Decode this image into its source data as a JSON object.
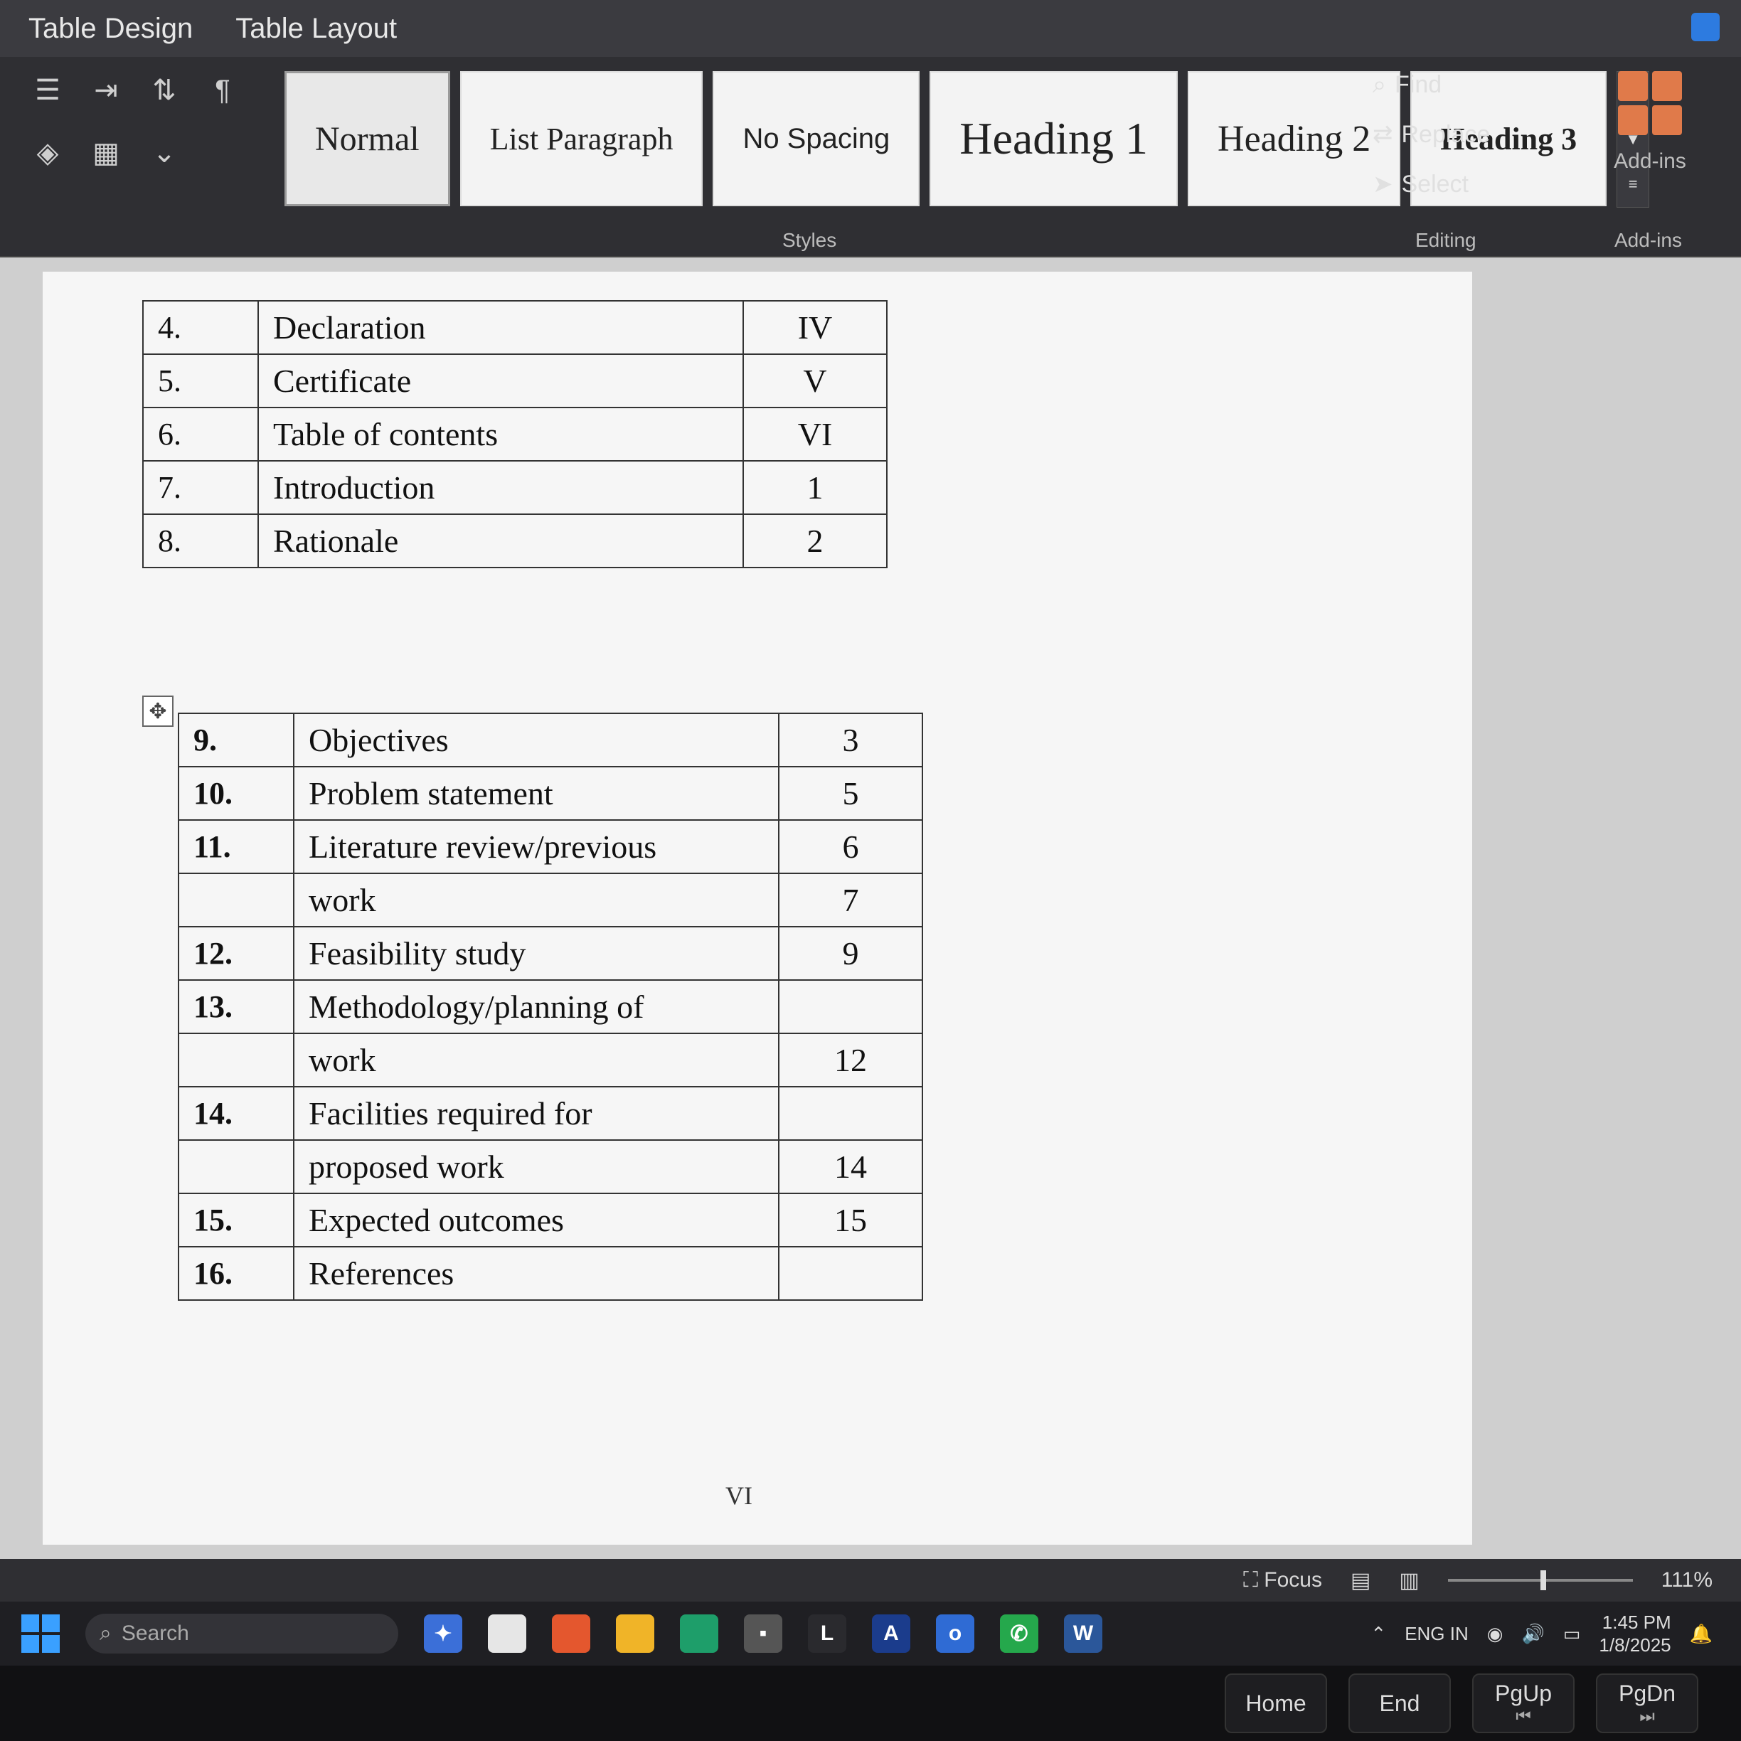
{
  "tabs": [
    "Table Design",
    "Table Layout"
  ],
  "ribbon": {
    "styles_label": "Styles",
    "styles": [
      {
        "label": "Normal"
      },
      {
        "label": "List Paragraph"
      },
      {
        "label": "No Spacing"
      },
      {
        "label": "Heading 1"
      },
      {
        "label": "Heading 2"
      },
      {
        "label": "Heading 3"
      }
    ],
    "editing": {
      "find": "Find",
      "replace": "Replace",
      "select": "Select",
      "label": "Editing"
    },
    "addins": {
      "button": "Add-ins",
      "label": "Add-ins"
    }
  },
  "document": {
    "table1": [
      {
        "num": "4.",
        "title": "Declaration",
        "page": "IV"
      },
      {
        "num": "5.",
        "title": "Certificate",
        "page": "V"
      },
      {
        "num": "6.",
        "title": "Table of contents",
        "page": "VI"
      },
      {
        "num": "7.",
        "title": "Introduction",
        "page": "1"
      },
      {
        "num": "8.",
        "title": "Rationale",
        "page": "2"
      }
    ],
    "table2": [
      {
        "num": "9.",
        "title": "Objectives",
        "page": "3"
      },
      {
        "num": "10.",
        "title": "Problem statement",
        "page": "5"
      },
      {
        "num": "11.",
        "title": "Literature review/previous",
        "page": "6"
      },
      {
        "num": "",
        "title": "work",
        "page": "7"
      },
      {
        "num": "12.",
        "title": "Feasibility study",
        "page": "9"
      },
      {
        "num": "13.",
        "title": "Methodology/planning of",
        "page": ""
      },
      {
        "num": "",
        "title": "work",
        "page": "12"
      },
      {
        "num": "14.",
        "title": "Facilities required for",
        "page": ""
      },
      {
        "num": "",
        "title": "proposed work",
        "page": "14"
      },
      {
        "num": "15.",
        "title": "Expected outcomes",
        "page": "15"
      },
      {
        "num": "16.",
        "title": "References",
        "page": ""
      }
    ],
    "page_footer": "VI"
  },
  "statusbar": {
    "focus": "Focus",
    "zoom": "111%"
  },
  "taskbar": {
    "search_placeholder": "Search",
    "lang_line1": "ENG",
    "lang_line2": "IN",
    "time": "1:45 PM",
    "date": "1/8/2025"
  },
  "keys": {
    "home": "Home",
    "end": "End",
    "pgup": "PgUp",
    "pgdn": "PgDn"
  }
}
